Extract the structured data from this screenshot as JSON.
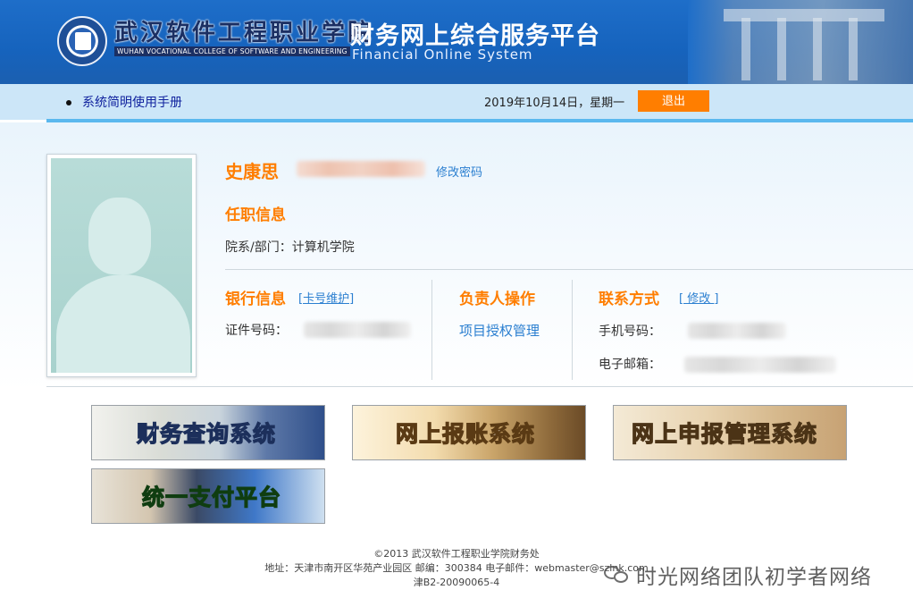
{
  "header": {
    "school_name_cn": "武汉软件工程职业学院",
    "school_name_en": "WUHAN VOCATIONAL COLLEGE OF SOFTWARE AND ENGINEERING",
    "system_title_cn": "财务网上综合服务平台",
    "system_title_en": "Financial Online System"
  },
  "navbar": {
    "manual_link": "系统简明使用手册",
    "date": "2019年10月14日，星期一",
    "logout": "退出"
  },
  "profile": {
    "name": "史康思",
    "change_password": "修改密码",
    "employment": {
      "title": "任职信息",
      "department_label": "院系/部门：",
      "department_value": "计算机学院"
    },
    "bank": {
      "title": "银行信息",
      "maintain_link": "[卡号维护]",
      "id_label": "证件号码："
    },
    "manager": {
      "title": "负责人操作",
      "auth_link": "项目授权管理"
    },
    "contact": {
      "title": "联系方式",
      "edit_link": "[ 修改 ]",
      "phone_label": "手机号码：",
      "email_label": "电子邮箱："
    }
  },
  "banners": {
    "finance_query": "财务查询系统",
    "online_reimburse": "网上报账系统",
    "online_declare": "网上申报管理系统",
    "unified_payment": "统一支付平台"
  },
  "footer": {
    "copyright": "©2013 武汉软件工程职业学院财务处",
    "address": "地址：天津市南开区华苑产业园区 邮编：300384 电子邮件：webmaster@szlnk.com",
    "icp": "津B2-20090065-4"
  },
  "watermark": {
    "text": "时光网络团队初学者网络"
  },
  "colors": {
    "header_blue": "#1663bd",
    "accent_orange": "#ff7e00",
    "link_blue": "#2b7fd0",
    "nav_bg": "#cce6f8"
  }
}
